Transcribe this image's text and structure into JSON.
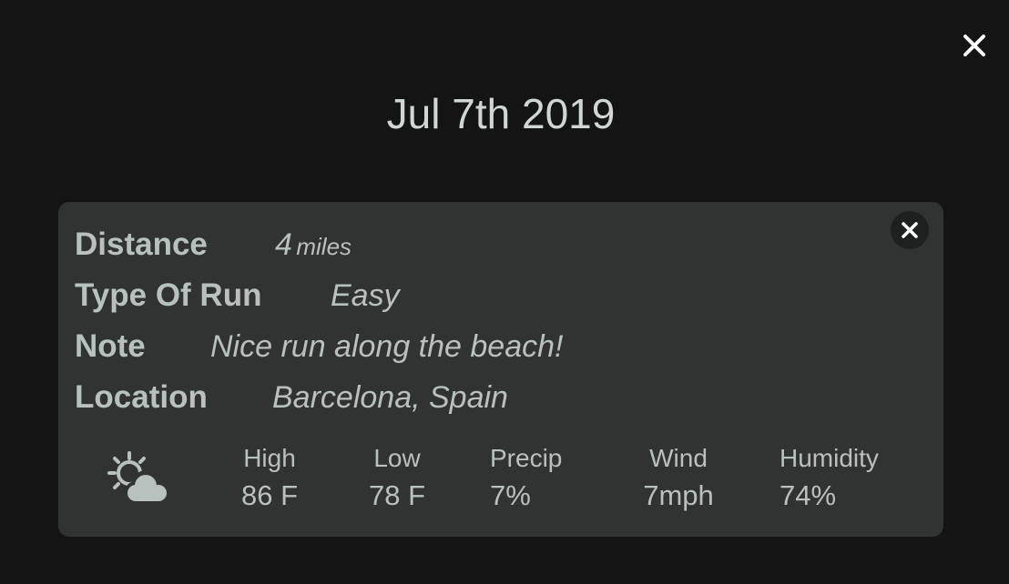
{
  "modal": {
    "title": "Jul 7th 2019"
  },
  "run": {
    "distance": {
      "label": "Distance",
      "value": "4",
      "unit": "miles"
    },
    "type": {
      "label": "Type Of Run",
      "value": "Easy"
    },
    "note": {
      "label": "Note",
      "value": "Nice run along the beach!"
    },
    "location": {
      "label": "Location",
      "value": "Barcelona, Spain"
    }
  },
  "weather": {
    "icon": "partly-cloudy-icon",
    "high": {
      "label": "High",
      "value": "86 F"
    },
    "low": {
      "label": "Low",
      "value": "78 F"
    },
    "precip": {
      "label": "Precip",
      "value": "7%"
    },
    "wind": {
      "label": "Wind",
      "value": "7mph"
    },
    "humidity": {
      "label": "Humidity",
      "value": "74%"
    }
  },
  "colors": {
    "background": "#141414",
    "card": "#313332",
    "text": "#b7c1be",
    "title": "#cfd6d4"
  }
}
